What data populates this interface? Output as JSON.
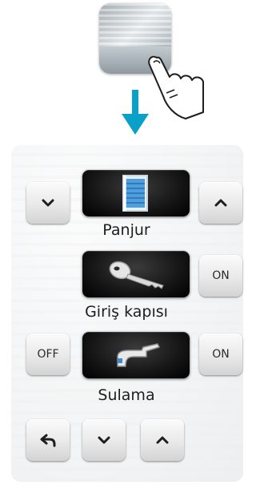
{
  "illustration": {
    "thumbnail_icon": "bedroom-shutter-thumbnail",
    "finger_icon": "tap-finger-icon",
    "arrow_icon": "arrow-down-icon",
    "arrow_color": "#0aa1c8"
  },
  "panel": {
    "shutter": {
      "label": "Panjur",
      "down_icon": "chevron-down-icon",
      "up_icon": "chevron-up-icon",
      "device_icon": "window-shutter-icon"
    },
    "door": {
      "label": "Giriş kapısı",
      "on_label": "ON",
      "device_icon": "key-icon"
    },
    "irrigation": {
      "label": "Sulama",
      "off_label": "OFF",
      "on_label": "ON",
      "device_icon": "faucet-icon"
    },
    "bottom": {
      "back_icon": "back-arrow-icon",
      "down_icon": "chevron-down-icon",
      "up_icon": "chevron-up-icon"
    }
  }
}
